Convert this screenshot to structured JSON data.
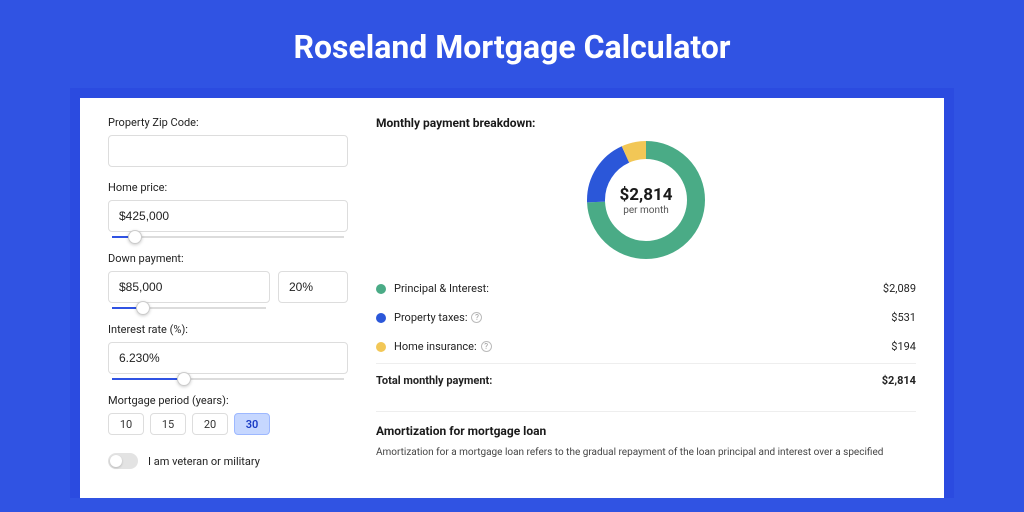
{
  "page_title": "Roseland Mortgage Calculator",
  "form": {
    "zip_label": "Property Zip Code:",
    "zip_value": "",
    "home_price_label": "Home price:",
    "home_price_value": "$425,000",
    "down_payment_label": "Down payment:",
    "down_payment_value": "$85,000",
    "down_payment_pct": "20%",
    "interest_label": "Interest rate (%):",
    "interest_value": "6.230%",
    "period_label": "Mortgage period (years):",
    "period_options": [
      "10",
      "15",
      "20",
      "30"
    ],
    "period_selected": "30",
    "veteran_label": "I am veteran or military"
  },
  "breakdown": {
    "header": "Monthly payment breakdown:",
    "center_amount": "$2,814",
    "center_sub": "per month",
    "items": [
      {
        "label": "Principal & Interest:",
        "value": "$2,089",
        "color": "#4aab86"
      },
      {
        "label": "Property taxes:",
        "value": "$531",
        "color": "#2b57d9",
        "info": true
      },
      {
        "label": "Home insurance:",
        "value": "$194",
        "color": "#f2c756",
        "info": true
      }
    ],
    "total_label": "Total monthly payment:",
    "total_value": "$2,814"
  },
  "amort": {
    "header": "Amortization for mortgage loan",
    "body": "Amortization for a mortgage loan refers to the gradual repayment of the loan principal and interest over a specified"
  },
  "chart_data": {
    "type": "pie",
    "title": "Monthly payment breakdown",
    "series": [
      {
        "name": "Principal & Interest",
        "value": 2089,
        "color": "#4aab86"
      },
      {
        "name": "Property taxes",
        "value": 531,
        "color": "#2b57d9"
      },
      {
        "name": "Home insurance",
        "value": 194,
        "color": "#f2c756"
      }
    ],
    "total": 2814,
    "center_label": "$2,814 per month"
  }
}
